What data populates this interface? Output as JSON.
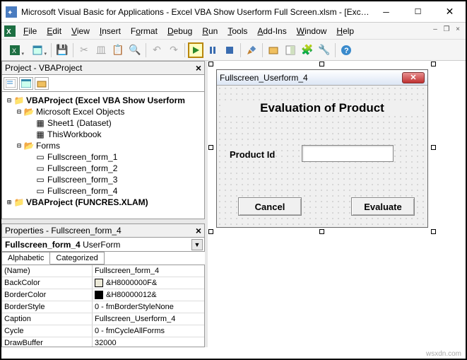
{
  "title": "Microsoft Visual Basic for Applications - Excel VBA Show Userform Full Screen.xlsm - [Exce...",
  "menus": [
    "File",
    "Edit",
    "View",
    "Insert",
    "Format",
    "Debug",
    "Run",
    "Tools",
    "Add-Ins",
    "Window",
    "Help"
  ],
  "project_panel": {
    "title": "Project - VBAProject",
    "tree": {
      "root1": "VBAProject (Excel VBA Show Userform",
      "folder1": "Microsoft Excel Objects",
      "sheet1": "Sheet1 (Dataset)",
      "thiswb": "ThisWorkbook",
      "folder2": "Forms",
      "form1": "Fullscreen_form_1",
      "form2": "Fullscreen_form_2",
      "form3": "Fullscreen_form_3",
      "form4": "Fullscreen_form_4",
      "root2": "VBAProject (FUNCRES.XLAM)"
    }
  },
  "properties_panel": {
    "title": "Properties - Fullscreen_form_4",
    "object": "Fullscreen_form_4",
    "object_type": "UserForm",
    "tabs": {
      "alpha": "Alphabetic",
      "cat": "Categorized"
    },
    "rows": {
      "name_k": "(Name)",
      "name_v": "Fullscreen_form_4",
      "backcolor_k": "BackColor",
      "backcolor_v": "&H8000000F&",
      "bordercolor_k": "BorderColor",
      "bordercolor_v": "&H80000012&",
      "borderstyle_k": "BorderStyle",
      "borderstyle_v": "0 - fmBorderStyleNone",
      "caption_k": "Caption",
      "caption_v": "Fullscreen_Userform_4",
      "cycle_k": "Cycle",
      "cycle_v": "0 - fmCycleAllForms",
      "draw_k": "DrawBuffer",
      "draw_v": "32000"
    }
  },
  "userform": {
    "caption": "Fullscreen_Userform_4",
    "heading": "Evaluation of Product",
    "label": "Product Id",
    "cancel": "Cancel",
    "evaluate": "Evaluate"
  },
  "watermark": "wsxdn.com"
}
